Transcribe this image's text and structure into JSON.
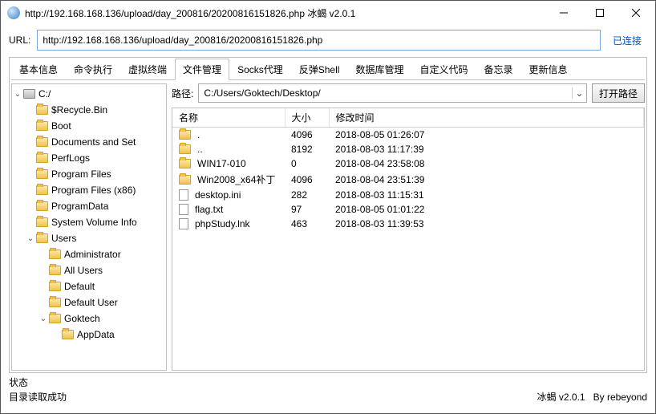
{
  "window": {
    "title": "http://192.168.168.136/upload/day_200816/20200816151826.php    冰蝎 v2.0.1"
  },
  "url": {
    "label": "URL:",
    "value": "http://192.168.168.136/upload/day_200816/20200816151826.php",
    "status": "已连接"
  },
  "tabs": [
    "基本信息",
    "命令执行",
    "虚拟终端",
    "文件管理",
    "Socks代理",
    "反弹Shell",
    "数据库管理",
    "自定义代码",
    "备忘录",
    "更新信息"
  ],
  "active_tab": 3,
  "tree": {
    "root": {
      "label": "C:/",
      "type": "drive",
      "expanded": true
    },
    "items": [
      {
        "label": "$Recycle.Bin",
        "depth": 1
      },
      {
        "label": "Boot",
        "depth": 1
      },
      {
        "label": "Documents and Set",
        "depth": 1
      },
      {
        "label": "PerfLogs",
        "depth": 1
      },
      {
        "label": "Program Files",
        "depth": 1
      },
      {
        "label": "Program Files (x86)",
        "depth": 1
      },
      {
        "label": "ProgramData",
        "depth": 1
      },
      {
        "label": "System Volume Info",
        "depth": 1
      },
      {
        "label": "Users",
        "depth": 1,
        "expanded": true
      },
      {
        "label": "Administrator",
        "depth": 2
      },
      {
        "label": "All Users",
        "depth": 2
      },
      {
        "label": "Default",
        "depth": 2
      },
      {
        "label": "Default User",
        "depth": 2
      },
      {
        "label": "Goktech",
        "depth": 2,
        "expanded": true
      },
      {
        "label": "AppData",
        "depth": 3
      }
    ]
  },
  "path": {
    "label": "路径:",
    "value": "C:/Users/Goktech/Desktop/",
    "open_btn": "打开路径"
  },
  "columns": {
    "name": "名称",
    "size": "大小",
    "mtime": "修改时间"
  },
  "files": [
    {
      "name": ".",
      "type": "folder",
      "size": "4096",
      "mtime": "2018-08-05 01:26:07"
    },
    {
      "name": "..",
      "type": "folder",
      "size": "8192",
      "mtime": "2018-08-03 11:17:39"
    },
    {
      "name": "WIN17-010",
      "type": "folder",
      "size": "0",
      "mtime": "2018-08-04 23:58:08"
    },
    {
      "name": "Win2008_x64补丁",
      "type": "folder",
      "size": "4096",
      "mtime": "2018-08-04 23:51:39"
    },
    {
      "name": "desktop.ini",
      "type": "file",
      "size": "282",
      "mtime": "2018-08-03 11:15:31"
    },
    {
      "name": "flag.txt",
      "type": "file",
      "size": "97",
      "mtime": "2018-08-05 01:01:22"
    },
    {
      "name": "phpStudy.lnk",
      "type": "file",
      "size": "463",
      "mtime": "2018-08-03 11:39:53"
    }
  ],
  "status": {
    "label": "状态",
    "message": "目录读取成功",
    "brand": "冰蝎 v2.0.1",
    "author": "By rebeyond"
  }
}
